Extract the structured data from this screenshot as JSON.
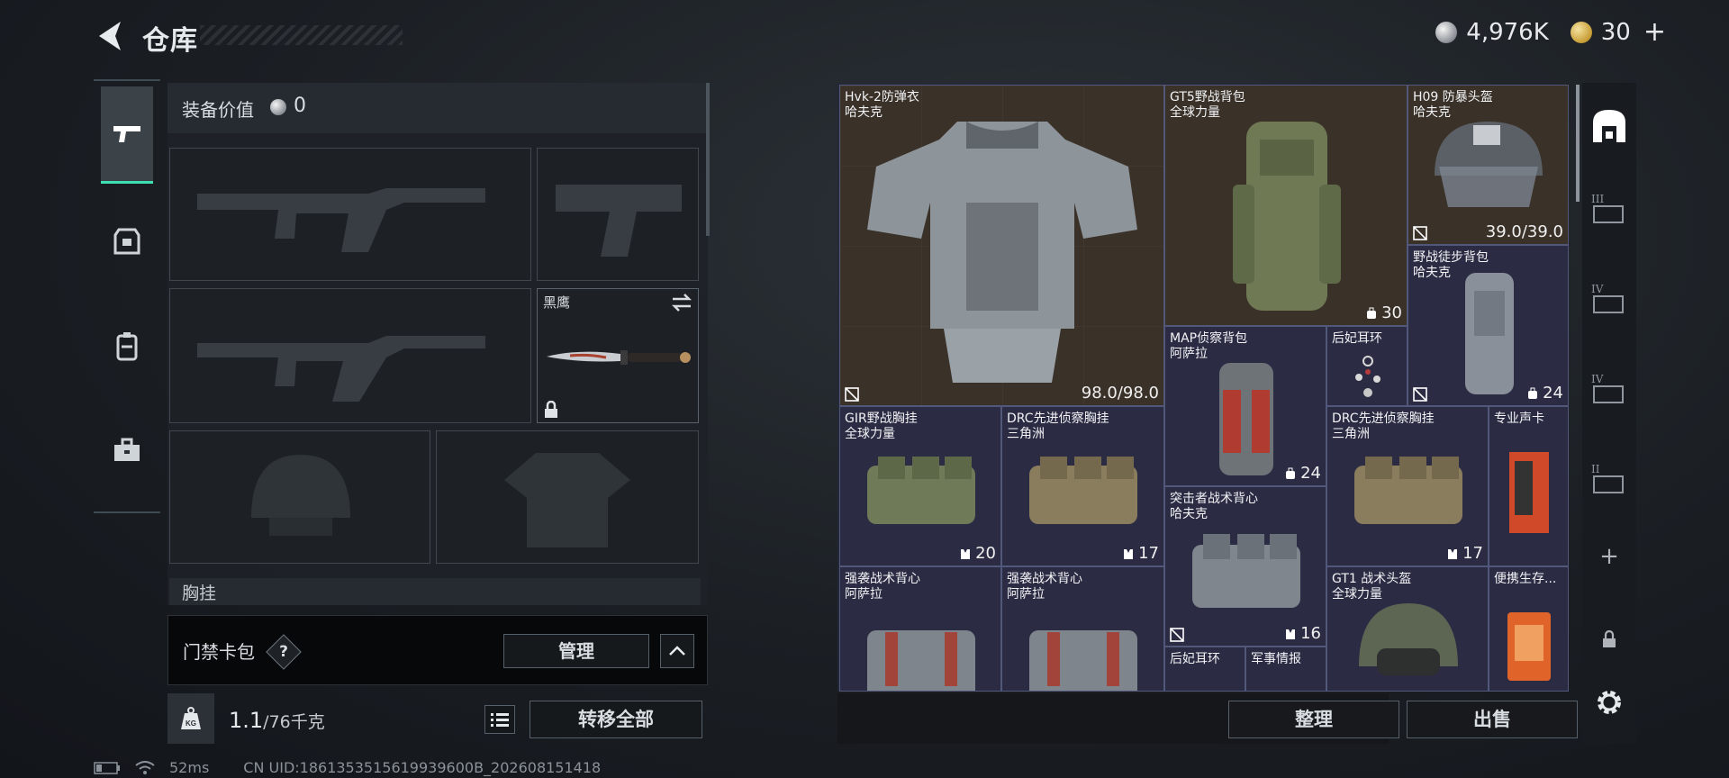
{
  "header": {
    "title": "仓库",
    "silver_amount": "4,976K",
    "gold_amount": "30",
    "add_label": "+"
  },
  "equipment": {
    "value_label": "装备价值",
    "value": "0",
    "melee_name": "黑鹰",
    "chest_label": "胸挂"
  },
  "keycard": {
    "label": "门禁卡包",
    "help": "?",
    "manage_label": "管理"
  },
  "weight": {
    "current": "1.1",
    "max": "/76千克",
    "transfer_label": "转移全部",
    "icon_label": "KG"
  },
  "status": {
    "ping": "52ms",
    "uid": "CN UID:1861353515619939600B_202608151418"
  },
  "inventory": {
    "items": [
      {
        "name": "Hvk-2防弹衣",
        "brand": "哈夫克",
        "badge": "98.0/98.0"
      },
      {
        "name": "GT5野战背包",
        "brand": "全球力量",
        "badge": "30"
      },
      {
        "name": "H09 防暴头盔",
        "brand": "哈夫克",
        "badge": "39.0/39.0"
      },
      {
        "name": "野战徒步背包",
        "brand": "哈夫克",
        "badge": "24"
      },
      {
        "name": "MAP侦察背包",
        "brand": "阿萨拉",
        "badge": "24"
      },
      {
        "name": "后妃耳环",
        "brand": "",
        "badge": ""
      },
      {
        "name": "GIR野战胸挂",
        "brand": "全球力量",
        "badge": "20"
      },
      {
        "name": "DRC先进侦察胸挂",
        "brand": "三角洲",
        "badge": "17"
      },
      {
        "name": "突击者战术背心",
        "brand": "哈夫克",
        "badge": "16"
      },
      {
        "name": "DRC先进侦察胸挂",
        "brand": "三角洲",
        "badge": "17"
      },
      {
        "name": "专业声卡",
        "brand": "",
        "badge": ""
      },
      {
        "name": "强袭战术背心",
        "brand": "阿萨拉",
        "badge": ""
      },
      {
        "name": "强袭战术背心",
        "brand": "阿萨拉",
        "badge": ""
      },
      {
        "name": "GT1 战术头盔",
        "brand": "全球力量",
        "badge": ""
      },
      {
        "name": "便携生存...",
        "brand": "",
        "badge": ""
      },
      {
        "name": "后妃耳环",
        "brand": "",
        "badge": ""
      },
      {
        "name": "军事情报",
        "brand": "",
        "badge": ""
      }
    ],
    "sort_label": "整理",
    "sell_label": "出售"
  },
  "right_tabs": {
    "tier_labels": [
      "III",
      "IV",
      "IV",
      "II"
    ],
    "add_label": "+"
  },
  "colors": {
    "accent": "#3ee0b3",
    "brown_tile": "#3a3129",
    "blue_tile": "#2b2c44",
    "panel": "#1e2228"
  }
}
